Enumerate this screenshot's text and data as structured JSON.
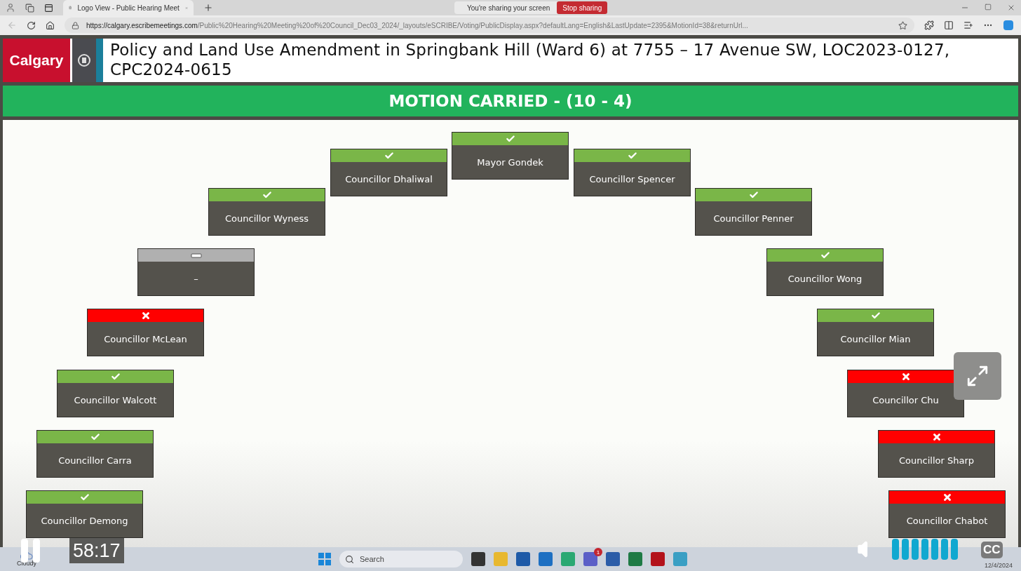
{
  "browser": {
    "tabs": [
      {
        "title": "Logo View - Public Hearing Meet",
        "selected": true
      }
    ],
    "sharing": {
      "message": "You're sharing your screen",
      "button": "Stop sharing"
    },
    "url_host": "https://calgary.escribemeetings.com",
    "url_path": "/Public%20Hearing%20Meeting%20of%20Council_Dec03_2024/_layouts/eSCRIBE/Voting/PublicDisplay.aspx?defaultLang=English&LastUpdate=2395&MotionId=38&returnUrl..."
  },
  "header": {
    "logo_text": "Calgary",
    "title": "Policy and Land Use Amendment in Springbank Hill (Ward 6) at 7755 – 17 Avenue SW, LOC2023-0127, CPC2024-0615"
  },
  "banner": {
    "text": "MOTION CARRIED - (10 - 4)"
  },
  "votes": [
    {
      "name": "Mayor Gondek",
      "kind": "for"
    },
    {
      "name": "Councillor Dhaliwal",
      "kind": "for"
    },
    {
      "name": "Councillor Spencer",
      "kind": "for"
    },
    {
      "name": "Councillor Wyness",
      "kind": "for"
    },
    {
      "name": "Councillor Penner",
      "kind": "for"
    },
    {
      "name": "–",
      "kind": "absent"
    },
    {
      "name": "Councillor Wong",
      "kind": "for"
    },
    {
      "name": "Councillor McLean",
      "kind": "against"
    },
    {
      "name": "Councillor Mian",
      "kind": "for"
    },
    {
      "name": "Councillor Walcott",
      "kind": "for"
    },
    {
      "name": "Councillor Chu",
      "kind": "against"
    },
    {
      "name": "Councillor Carra",
      "kind": "for"
    },
    {
      "name": "Councillor Sharp",
      "kind": "against"
    },
    {
      "name": "Councillor Demong",
      "kind": "for"
    },
    {
      "name": "Councillor Chabot",
      "kind": "against"
    }
  ],
  "player": {
    "time": "58:17",
    "playing": true,
    "cc": "CC"
  },
  "taskbar": {
    "weather": "Cloudy",
    "search_placeholder": "Search",
    "teams_badge": "1",
    "date": "12/4/2024"
  }
}
